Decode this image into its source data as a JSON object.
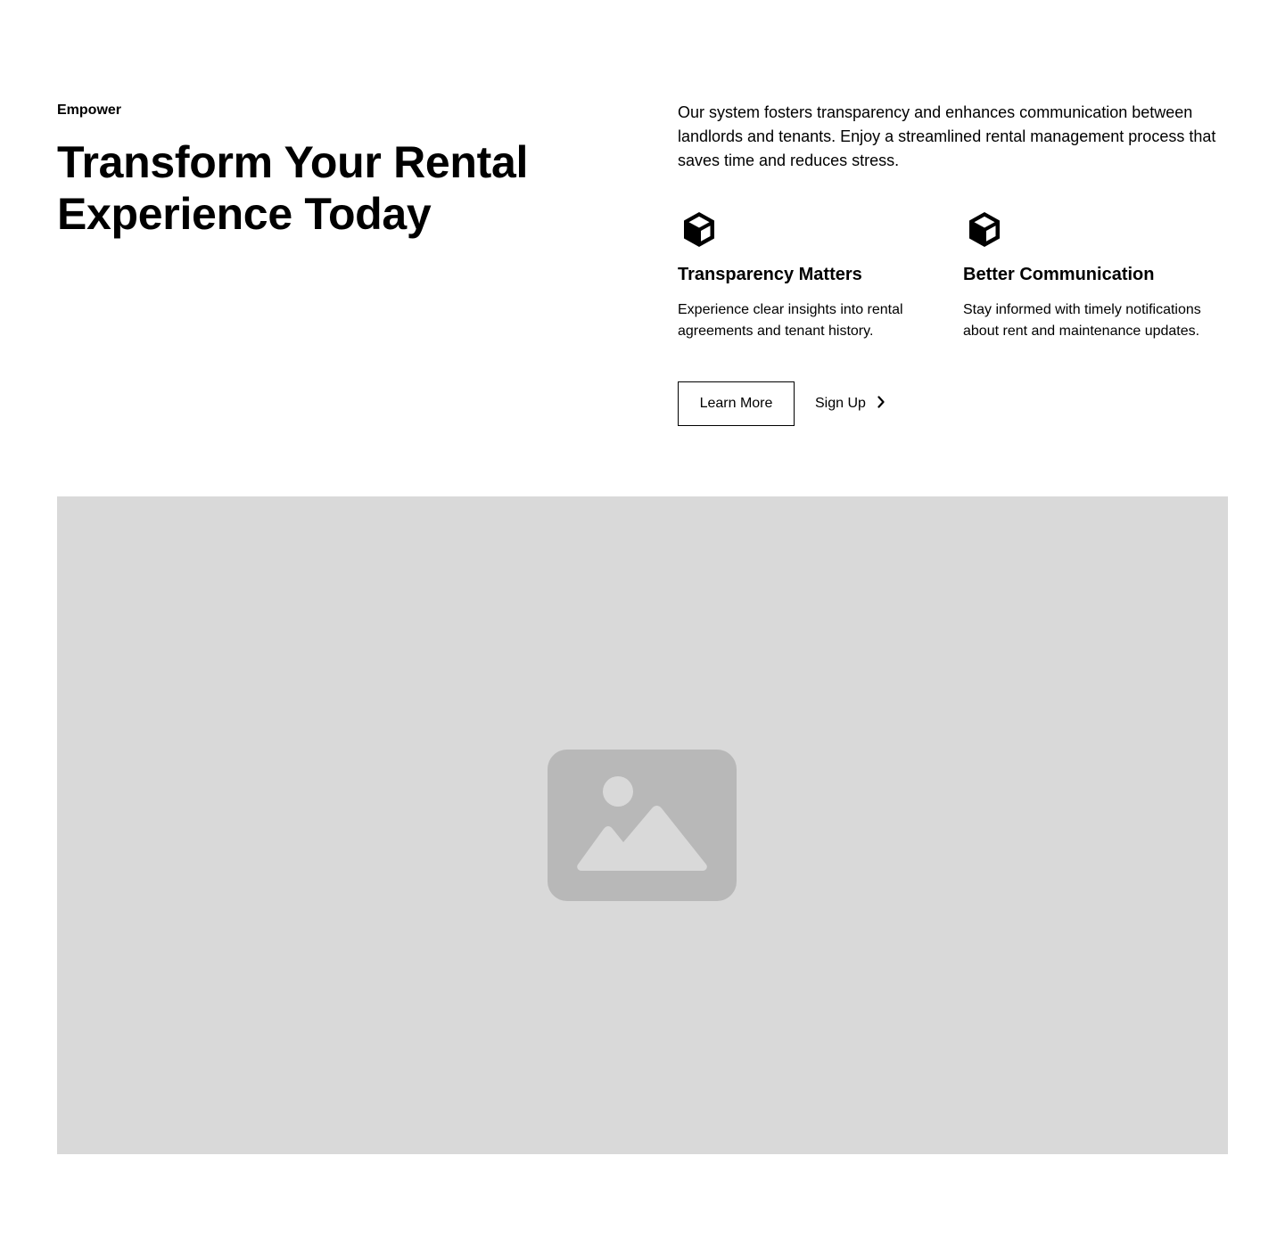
{
  "hero": {
    "eyebrow": "Empower",
    "headline": "Transform Your Rental Experience Today",
    "description": "Our system fosters transparency and enhances communication between landlords and tenants. Enjoy a streamlined rental management process that saves time and reduces stress."
  },
  "features": [
    {
      "icon": "cube-icon",
      "title": "Transparency Matters",
      "description": "Experience clear insights into rental agreements and tenant history."
    },
    {
      "icon": "cube-icon",
      "title": "Better Communication",
      "description": "Stay informed with timely notifications about rent and maintenance updates."
    }
  ],
  "actions": {
    "primary_label": "Learn More",
    "secondary_label": "Sign Up",
    "secondary_icon": "chevron-right-icon"
  },
  "media": {
    "icon": "image-placeholder-icon",
    "background_color": "#d9d9d9",
    "icon_color": "#b8b8b8"
  }
}
